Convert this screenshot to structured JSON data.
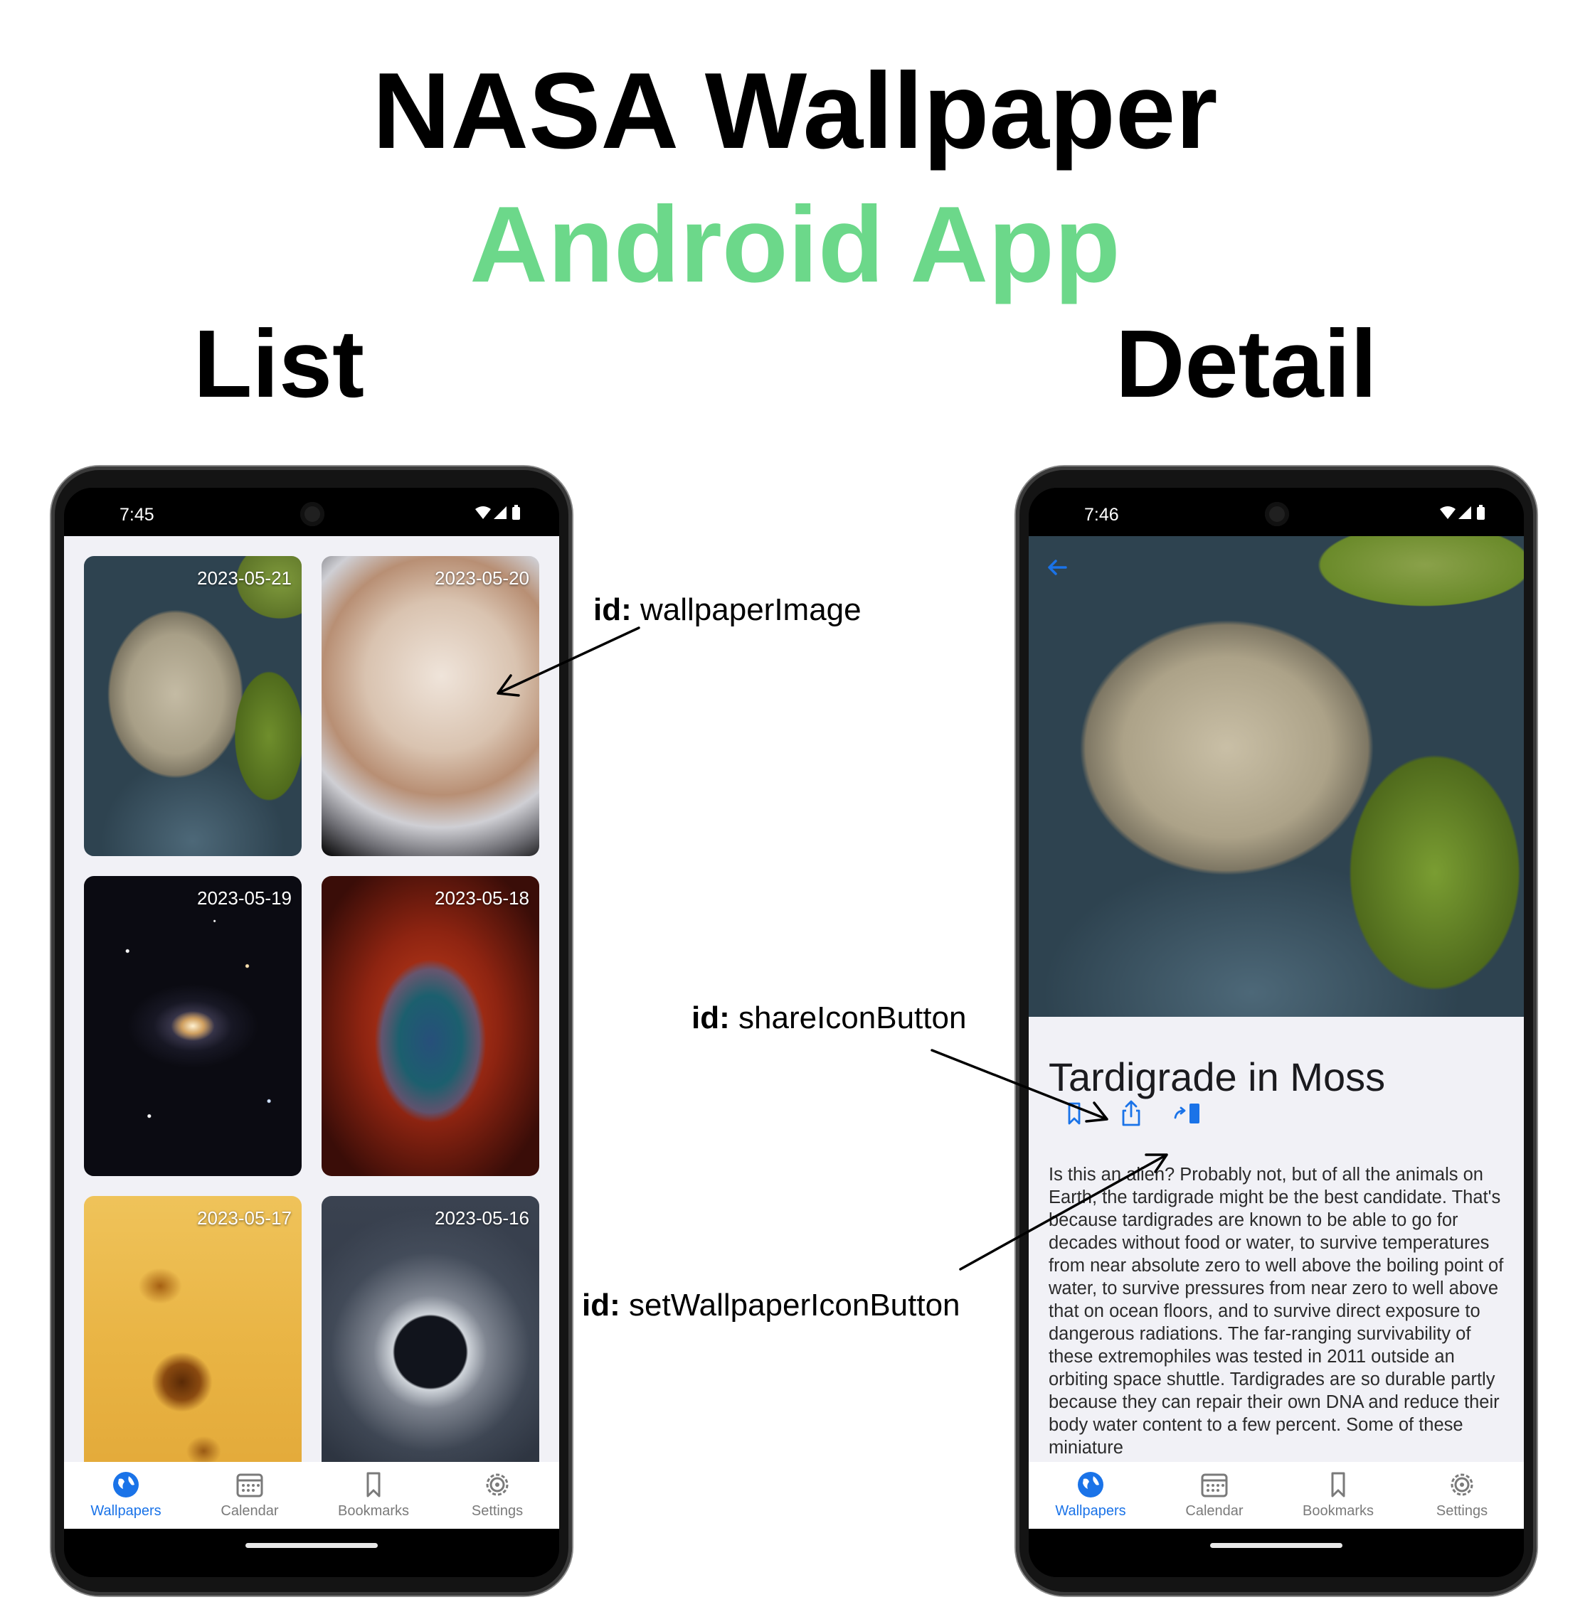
{
  "header": {
    "title_line1": "NASA Wallpaper",
    "title_line2": "Android App",
    "title_line2_color": "#6cd88a",
    "list_label": "List",
    "detail_label": "Detail"
  },
  "list_screen": {
    "status_time": "7:45",
    "cards": [
      {
        "date": "2023-05-21",
        "image": "tardigrade"
      },
      {
        "date": "2023-05-20",
        "image": "europa"
      },
      {
        "date": "2023-05-19",
        "image": "spiral-galaxy"
      },
      {
        "date": "2023-05-18",
        "image": "nebula"
      },
      {
        "date": "2023-05-17",
        "image": "sunspots"
      },
      {
        "date": "2023-05-16",
        "image": "solar-eclipse"
      }
    ]
  },
  "detail_screen": {
    "status_time": "7:46",
    "title": "Tardigrade in Moss",
    "explanation": "Is this an alien?  Probably not, but of all the animals on Earth, the tardigrade might be the best candidate. That's because tardigrades are known to be able to go for decades without food or water, to survive temperatures from near absolute zero to well above the boiling point of water, to survive pressures from near zero to well above that on ocean floors, and to survive direct exposure to dangerous radiations.  The far-ranging survivability of these extremophiles was tested in 2011 outside an orbiting space shuttle. Tardigrades are so durable partly because they can repair their own DNA and reduce their body water content to a few percent. Some of these miniature",
    "actions": [
      "bookmark-icon",
      "share-icon",
      "set-wallpaper-icon"
    ]
  },
  "bottom_nav": {
    "items": [
      {
        "label": "Wallpapers",
        "icon": "globe-icon",
        "active": true
      },
      {
        "label": "Calendar",
        "icon": "calendar-icon",
        "active": false
      },
      {
        "label": "Bookmarks",
        "icon": "bookmark-icon",
        "active": false
      },
      {
        "label": "Settings",
        "icon": "gear-icon",
        "active": false
      }
    ]
  },
  "annotations": {
    "prefix": "id:",
    "wallpaper_image": "wallpaperImage",
    "share_button": "shareIconButton",
    "set_wallpaper_button": "setWallpaperIconButton"
  },
  "colors": {
    "accent_blue": "#1a73e8",
    "inactive_gray": "#7a7a7a",
    "content_background": "#f1f1f6"
  }
}
